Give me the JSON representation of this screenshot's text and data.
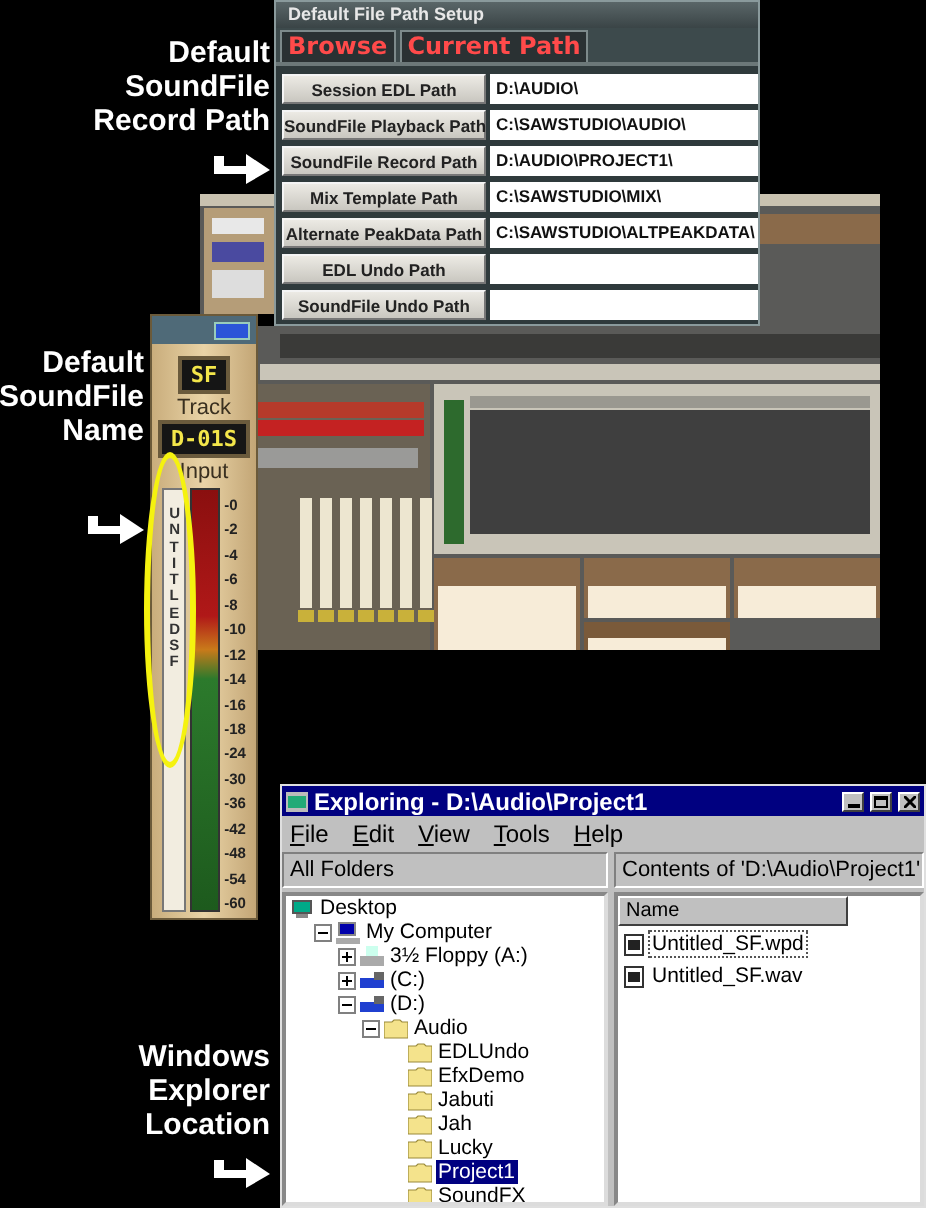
{
  "callouts": [
    {
      "lines": [
        "Default",
        "SoundFile",
        "Record Path"
      ]
    },
    {
      "lines": [
        "Default",
        "SoundFile",
        "Name"
      ]
    },
    {
      "lines": [
        "Windows",
        "Explorer",
        "Location"
      ]
    }
  ],
  "path_setup": {
    "title": "Default File Path Setup",
    "tabs": [
      {
        "label": "Browse"
      },
      {
        "label": "Current Path"
      }
    ],
    "rows": [
      {
        "label": "Session EDL Path",
        "value": "D:\\AUDIO\\"
      },
      {
        "label": "SoundFile Playback Path",
        "value": "C:\\SAWSTUDIO\\AUDIO\\"
      },
      {
        "label": "SoundFile Record Path",
        "value": "D:\\AUDIO\\PROJECT1\\"
      },
      {
        "label": "Mix Template Path",
        "value": "C:\\SAWSTUDIO\\MIX\\"
      },
      {
        "label": "Alternate PeakData Path",
        "value": "C:\\SAWSTUDIO\\ALTPEAKDATA\\"
      },
      {
        "label": "EDL Undo Path",
        "value": ""
      },
      {
        "label": "SoundFile Undo Path",
        "value": ""
      }
    ]
  },
  "track_strip": {
    "source": "SF",
    "track_label": "Track",
    "track": "D-01S",
    "input_label": "Input",
    "soundfile_name": "UNTITLED SF",
    "scale": [
      "-0",
      "-2",
      "-4",
      "-6",
      "-8",
      "-10",
      "-12",
      "-14",
      "-16",
      "-18",
      "-24",
      "-30",
      "-36",
      "-42",
      "-48",
      "-54",
      "-60"
    ]
  },
  "explorer": {
    "title": "Exploring - D:\\Audio\\Project1",
    "menu": [
      "File",
      "Edit",
      "View",
      "Tools",
      "Help"
    ],
    "folders_header": "All Folders",
    "contents_header": "Contents of 'D:\\Audio\\Project1'",
    "tree": [
      {
        "label": "Desktop",
        "kind": "desktop",
        "selected": false,
        "children": [
          {
            "label": "My Computer",
            "kind": "computer",
            "selected": false,
            "expanded": true,
            "children": [
              {
                "label": "3½ Floppy (A:)",
                "kind": "floppy",
                "selected": false,
                "expanded": false
              },
              {
                "label": "(C:)",
                "kind": "drive",
                "selected": false,
                "expanded": false
              },
              {
                "label": "(D:)",
                "kind": "drive",
                "selected": false,
                "expanded": true,
                "children": [
                  {
                    "label": "Audio",
                    "kind": "folder",
                    "selected": false,
                    "expanded": true,
                    "children": [
                      {
                        "label": "EDLUndo",
                        "kind": "folder",
                        "selected": false
                      },
                      {
                        "label": "EfxDemo",
                        "kind": "folder",
                        "selected": false
                      },
                      {
                        "label": "Jabuti",
                        "kind": "folder",
                        "selected": false
                      },
                      {
                        "label": "Jah",
                        "kind": "folder",
                        "selected": false
                      },
                      {
                        "label": "Lucky",
                        "kind": "folder",
                        "selected": false
                      },
                      {
                        "label": "Project1",
                        "kind": "folder",
                        "selected": true
                      },
                      {
                        "label": "SoundFX",
                        "kind": "folder",
                        "selected": false
                      }
                    ]
                  }
                ]
              }
            ]
          }
        ]
      }
    ],
    "columns": [
      "Name"
    ],
    "files": [
      {
        "name": "Untitled_SF.wpd",
        "selected": true
      },
      {
        "name": "Untitled_SF.wav",
        "selected": false
      }
    ]
  }
}
